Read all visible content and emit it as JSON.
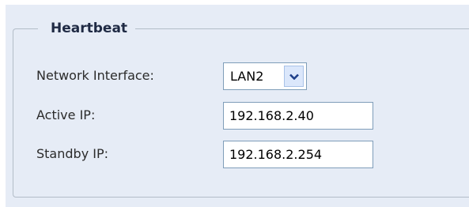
{
  "fieldset": {
    "legend": "Heartbeat"
  },
  "network_interface": {
    "label": "Network Interface:",
    "selected": "LAN2",
    "dropdown_icon": "chevron-down-icon"
  },
  "active_ip": {
    "label": "Active IP:",
    "value": "192.168.2.40"
  },
  "standby_ip": {
    "label": "Standby IP:",
    "value": "192.168.2.254"
  },
  "colors": {
    "panel_background": "#e6ecf6",
    "border": "#7f9db9",
    "legend_text": "#1f2a44",
    "arrow_button": "#dbe7fb",
    "arrow_glyph": "#1e3f8a"
  }
}
